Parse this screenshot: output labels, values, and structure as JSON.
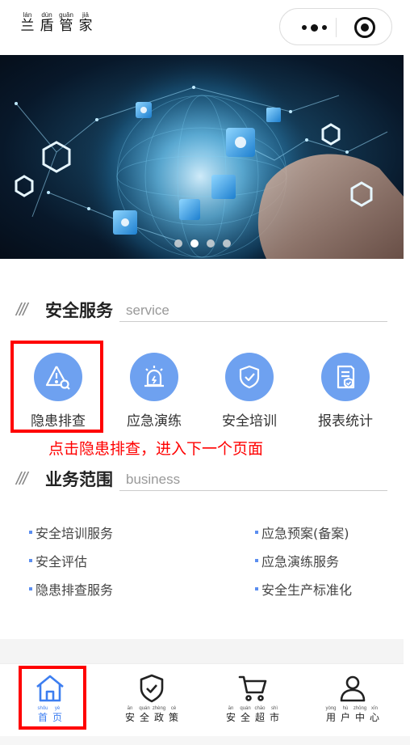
{
  "header": {
    "brand": [
      {
        "py": "lán",
        "hz": "兰"
      },
      {
        "py": "dùn",
        "hz": "盾"
      },
      {
        "py": "guǎn",
        "hz": "管"
      },
      {
        "py": "jiā",
        "hz": "家"
      }
    ],
    "menu_icon": "more-dots-icon",
    "close_icon": "target-circle-icon"
  },
  "banner": {
    "slide_count": 4,
    "active_slide": 1
  },
  "services_section": {
    "title": "安全服务",
    "subtitle": "service",
    "items": [
      {
        "label": "隐患排查",
        "icon": "warning-search-icon"
      },
      {
        "label": "应急演练",
        "icon": "alarm-siren-icon"
      },
      {
        "label": "安全培训",
        "icon": "shield-check-icon"
      },
      {
        "label": "报表统计",
        "icon": "report-document-icon"
      }
    ]
  },
  "hint_text": "点击隐患排查，进入下一个页面",
  "business_section": {
    "title": "业务范围",
    "subtitle": "business",
    "items": [
      "安全培训服务",
      "应急预案(备案)",
      "安全评估",
      "应急演练服务",
      "隐患排查服务",
      "安全生产标准化"
    ]
  },
  "tabbar": {
    "active_color": "#3d7ef0",
    "tabs": [
      {
        "chars": [
          {
            "py": "shǒu",
            "hz": "首"
          },
          {
            "py": "yè",
            "hz": "页"
          }
        ],
        "icon": "home-icon"
      },
      {
        "chars": [
          {
            "py": "ān",
            "hz": "安"
          },
          {
            "py": "quán",
            "hz": "全"
          },
          {
            "py": "zhèng",
            "hz": "政"
          },
          {
            "py": "cè",
            "hz": "策"
          }
        ],
        "icon": "shield-check-icon"
      },
      {
        "chars": [
          {
            "py": "ān",
            "hz": "安"
          },
          {
            "py": "quán",
            "hz": "全"
          },
          {
            "py": "chāo",
            "hz": "超"
          },
          {
            "py": "shì",
            "hz": "市"
          }
        ],
        "icon": "shopping-cart-icon"
      },
      {
        "chars": [
          {
            "py": "yòng",
            "hz": "用"
          },
          {
            "py": "hù",
            "hz": "户"
          },
          {
            "py": "zhōng",
            "hz": "中"
          },
          {
            "py": "xīn",
            "hz": "心"
          }
        ],
        "icon": "user-icon"
      }
    ]
  }
}
